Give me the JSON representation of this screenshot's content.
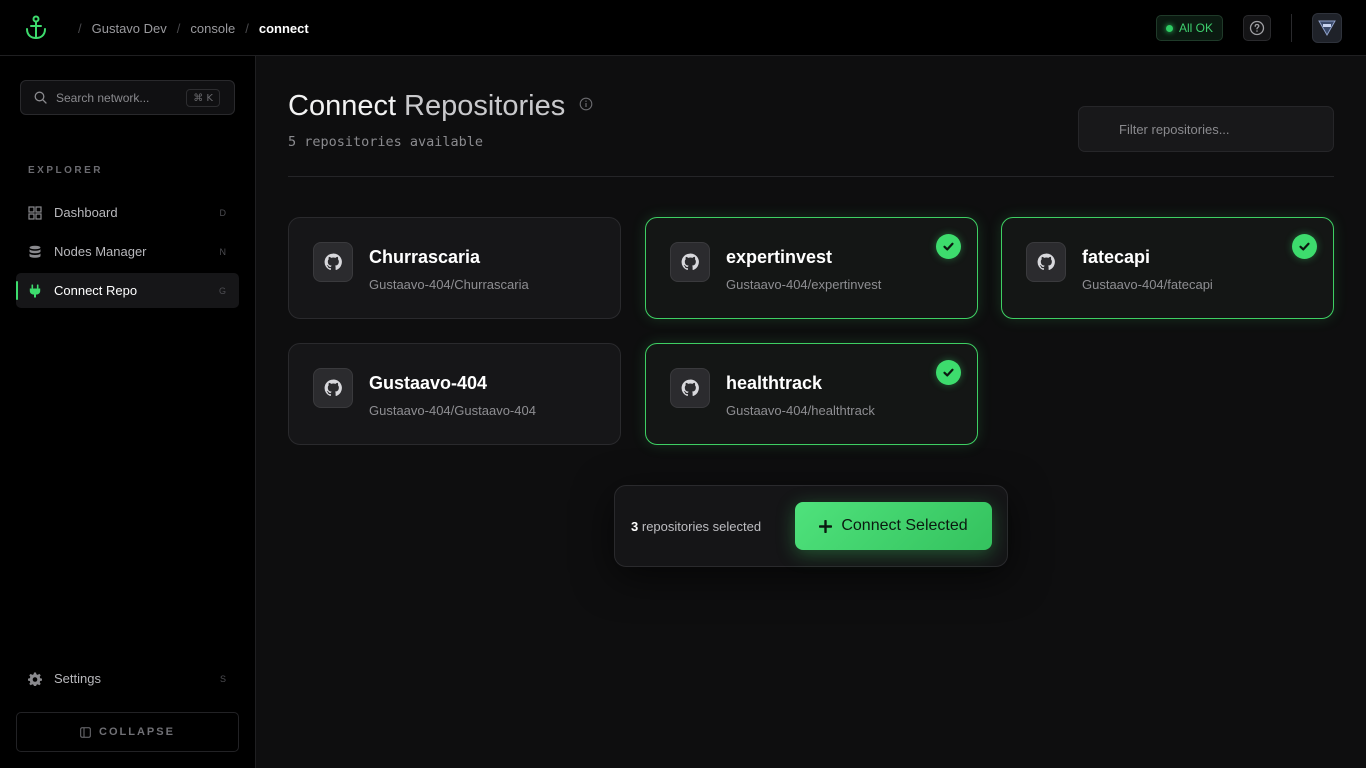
{
  "header": {
    "breadcrumbs": [
      "Gustavo Dev",
      "console",
      "connect"
    ],
    "status_label": "All OK"
  },
  "sidebar": {
    "search_placeholder": "Search network...",
    "search_shortcut": "⌘ K",
    "section_label": "EXPLORER",
    "items": [
      {
        "label": "Dashboard",
        "hotkey": "D",
        "icon": "dashboard-icon"
      },
      {
        "label": "Nodes Manager",
        "hotkey": "N",
        "icon": "database-icon"
      },
      {
        "label": "Connect Repo",
        "hotkey": "G",
        "icon": "plug-icon",
        "active": true
      }
    ],
    "settings": {
      "label": "Settings",
      "hotkey": "S",
      "icon": "gear-icon"
    },
    "collapse_label": "COLLAPSE"
  },
  "main": {
    "title_prefix": "Connect",
    "title_suffix": "Repositories",
    "subtitle": "5 repositories available",
    "filter_placeholder": "Filter repositories..."
  },
  "repos": [
    {
      "name": "Churrascaria",
      "path": "Gustaavo-404/Churrascaria",
      "selected": false
    },
    {
      "name": "expertinvest",
      "path": "Gustaavo-404/expertinvest",
      "selected": true
    },
    {
      "name": "fatecapi",
      "path": "Gustaavo-404/fatecapi",
      "selected": true
    },
    {
      "name": "Gustaavo-404",
      "path": "Gustaavo-404/Gustaavo-404",
      "selected": false
    },
    {
      "name": "healthtrack",
      "path": "Gustaavo-404/healthtrack",
      "selected": true
    }
  ],
  "action_bar": {
    "selected_count": "3",
    "selected_suffix": "repositories selected",
    "connect_label": "Connect Selected"
  },
  "colors": {
    "accent": "#3ddc6d",
    "background": "#0e0e0f",
    "card": "#161618"
  }
}
